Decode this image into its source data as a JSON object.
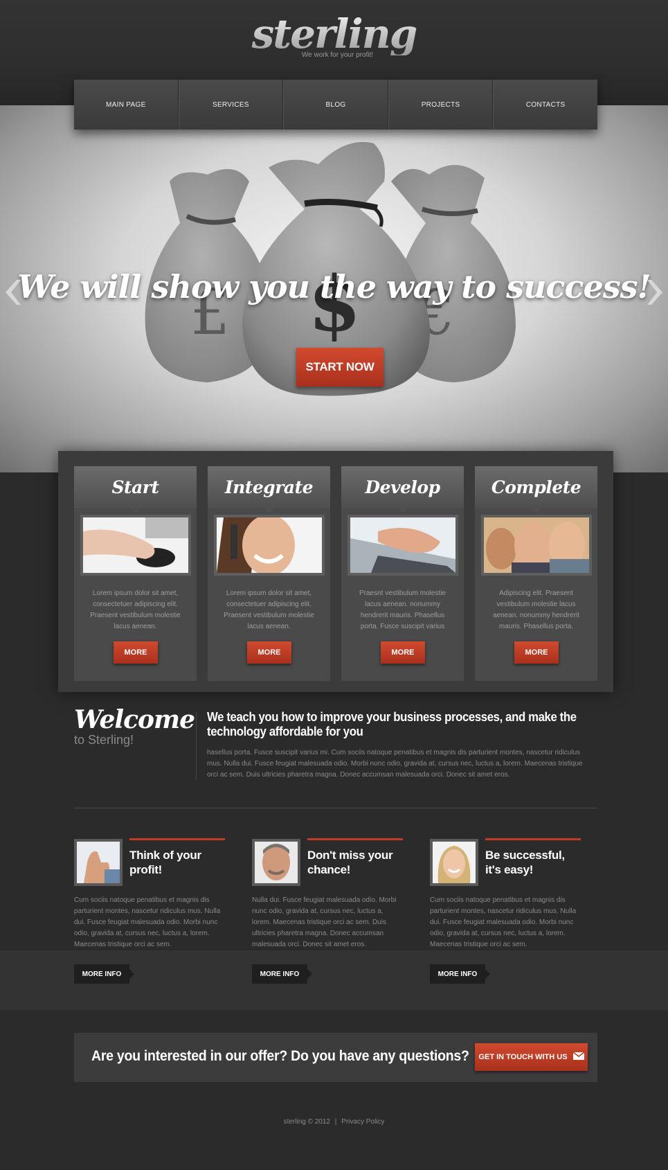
{
  "header": {
    "logo": "sterling",
    "tagline": "We work for your profit!"
  },
  "nav": [
    {
      "label": "MAIN PAGE"
    },
    {
      "label": "SERVICES"
    },
    {
      "label": "BLOG"
    },
    {
      "label": "PROJECTS"
    },
    {
      "label": "CONTACTS"
    }
  ],
  "hero": {
    "title": "We will show you the way to success!",
    "button": "START NOW",
    "prev_icon": "chevron-left-icon",
    "next_icon": "chevron-right-icon"
  },
  "cards": [
    {
      "title": "Start",
      "text": "Lorem ipsum dolor sit amet, consectetuer adipiscing elit. Praesent vestibulum molestie lacus aenean.",
      "button": "MORE",
      "image": "hand-on-mouse"
    },
    {
      "title": "Integrate",
      "text": "Lorem ipsum dolor sit amet, consectetuer adipiscing elit. Praesent vestibulum molestie lacus aenean.",
      "button": "MORE",
      "image": "woman-on-phone"
    },
    {
      "title": "Develop",
      "text": "Praesnt vestibulum molestie lacus aenean. nonummy hendrerit mauris. Phasellus porta. Fusce suscipit varius",
      "button": "MORE",
      "image": "hands-on-laptop"
    },
    {
      "title": "Complete",
      "text": "Adipiscing elit. Praesent vestibulum molestie lacus aenean. nonummy hendrerit mauris. Phasellus porta.",
      "button": "MORE",
      "image": "business-people"
    }
  ],
  "welcome": {
    "title": "Welcome",
    "subtitle": "to Sterling!",
    "heading": "We teach you how to improve your business processes, and make the technology affordable for you",
    "body": "hasellus porta. Fusce suscipit varius mi. Cum sociis natoque penatibus et magnis dis parturient montes, nascetur ridiculus mus. Nulla dui. Fusce feugiat malesuada odio. Morbi nunc odio, gravida at, cursus nec, luctus a, lorem. Maecenas tristique orci ac sem. Duis ultricies pharetra magna.  Donec accumsan malesuada orci. Donec sit amet eros."
  },
  "info": [
    {
      "title": "Think of your profit!",
      "text": "Cum sociis natoque penatibus et magnis dis parturient montes, nascetur ridiculus mus. Nulla dui. Fusce feugiat malesuada odio. Morbi nunc odio, gravida at, cursus nec, luctus a, lorem. Maecenas tristique orci ac sem.",
      "button": "MORE INFO",
      "image": "thumbs-up"
    },
    {
      "title": "Don't miss your chance!",
      "text": "Nulla dui. Fusce feugiat malesuada odio. Morbi nunc odio, gravida at, cursus nec, luctus a, lorem. Maecenas tristique orci ac sem. Duis ultricies pharetra magna. Donec accumsan malesuada orci. Donec sit amet eros.",
      "button": "MORE INFO",
      "image": "smiling-man"
    },
    {
      "title": "Be successful, it's easy!",
      "text": "Cum sociis natoque penatibus et magnis dis parturient montes, nascetur ridiculus mus. Nulla dui. Fusce feugiat malesuada odio. Morbi nunc odio, gravida at, cursus nec, luctus a, lorem. Maecenas tristique orci ac sem.",
      "button": "MORE INFO",
      "image": "smiling-woman"
    }
  ],
  "cta": {
    "text": "Are you interested in our offer? Do you have any questions?",
    "button": "GET IN TOUCH WITH US",
    "icon": "envelope-icon"
  },
  "footer": {
    "copyright": "sterling ©  2012",
    "separator": "|",
    "privacy": "Privacy Policy"
  },
  "colors": {
    "accent": "#c23c24",
    "background": "#2b2b2b",
    "panel": "#4a4a4a"
  }
}
